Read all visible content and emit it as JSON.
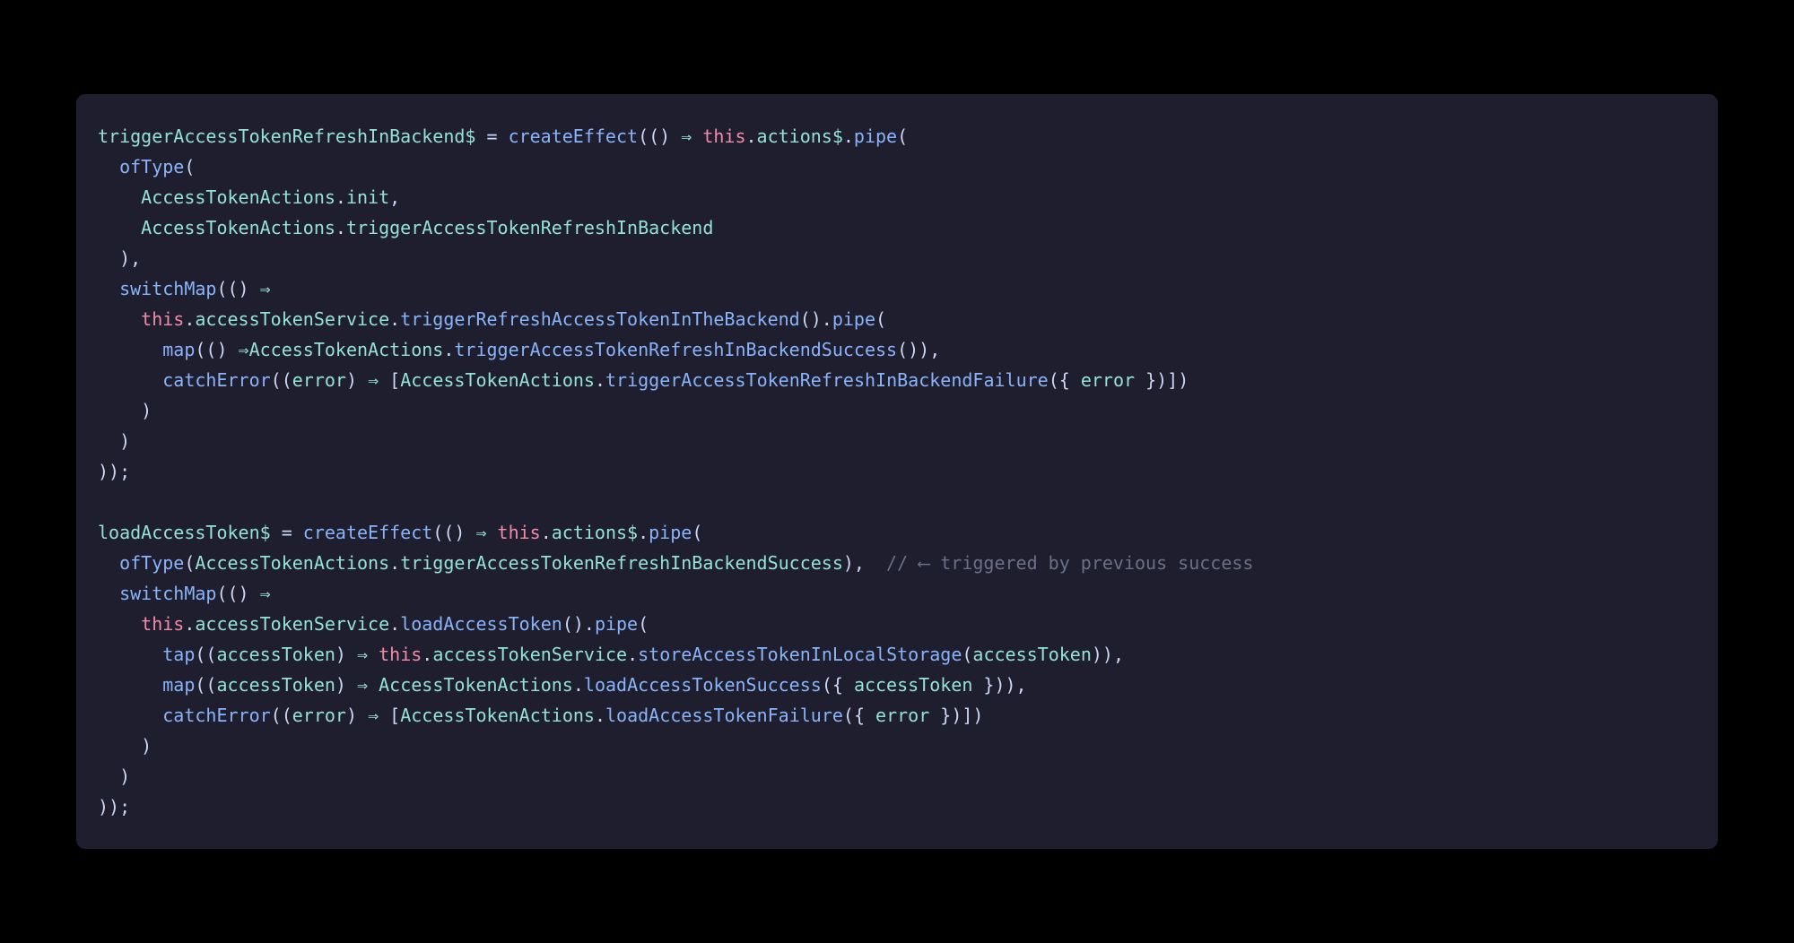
{
  "colors": {
    "bg": "#000000",
    "panel": "#1e1e2e",
    "text": "#cdd6f4",
    "ident": "#94e2d5",
    "func": "#89b4fa",
    "keyword": "#f38ba8",
    "comment": "#6c7086"
  },
  "code": {
    "lines": [
      [
        {
          "t": "triggerAccessTokenRefreshInBackend$",
          "c": "ident"
        },
        {
          "t": " = ",
          "c": "op"
        },
        {
          "t": "createEffect",
          "c": "func"
        },
        {
          "t": "(() ",
          "c": "op"
        },
        {
          "t": "⇒",
          "c": "arrow"
        },
        {
          "t": " ",
          "c": "op"
        },
        {
          "t": "this",
          "c": "keyword"
        },
        {
          "t": ".",
          "c": "op"
        },
        {
          "t": "actions$",
          "c": "ident"
        },
        {
          "t": ".",
          "c": "op"
        },
        {
          "t": "pipe",
          "c": "func"
        },
        {
          "t": "(",
          "c": "op"
        }
      ],
      [
        {
          "t": "  ",
          "c": "op"
        },
        {
          "t": "ofType",
          "c": "func"
        },
        {
          "t": "(",
          "c": "op"
        }
      ],
      [
        {
          "t": "    ",
          "c": "op"
        },
        {
          "t": "AccessTokenActions",
          "c": "ident"
        },
        {
          "t": ".",
          "c": "op"
        },
        {
          "t": "init",
          "c": "ident"
        },
        {
          "t": ",",
          "c": "op"
        }
      ],
      [
        {
          "t": "    ",
          "c": "op"
        },
        {
          "t": "AccessTokenActions",
          "c": "ident"
        },
        {
          "t": ".",
          "c": "op"
        },
        {
          "t": "triggerAccessTokenRefreshInBackend",
          "c": "ident"
        }
      ],
      [
        {
          "t": "  ),",
          "c": "op"
        }
      ],
      [
        {
          "t": "  ",
          "c": "op"
        },
        {
          "t": "switchMap",
          "c": "func"
        },
        {
          "t": "(() ",
          "c": "op"
        },
        {
          "t": "⇒",
          "c": "arrow"
        }
      ],
      [
        {
          "t": "    ",
          "c": "op"
        },
        {
          "t": "this",
          "c": "keyword"
        },
        {
          "t": ".",
          "c": "op"
        },
        {
          "t": "accessTokenService",
          "c": "ident"
        },
        {
          "t": ".",
          "c": "op"
        },
        {
          "t": "triggerRefreshAccessTokenInTheBackend",
          "c": "func"
        },
        {
          "t": "().",
          "c": "op"
        },
        {
          "t": "pipe",
          "c": "func"
        },
        {
          "t": "(",
          "c": "op"
        }
      ],
      [
        {
          "t": "      ",
          "c": "op"
        },
        {
          "t": "map",
          "c": "func"
        },
        {
          "t": "(() ",
          "c": "op"
        },
        {
          "t": "⇒",
          "c": "arrow"
        },
        {
          "t": "AccessTokenActions",
          "c": "ident"
        },
        {
          "t": ".",
          "c": "op"
        },
        {
          "t": "triggerAccessTokenRefreshInBackendSuccess",
          "c": "func"
        },
        {
          "t": "()),",
          "c": "op"
        }
      ],
      [
        {
          "t": "      ",
          "c": "op"
        },
        {
          "t": "catchError",
          "c": "func"
        },
        {
          "t": "((",
          "c": "op"
        },
        {
          "t": "error",
          "c": "ident"
        },
        {
          "t": ") ",
          "c": "op"
        },
        {
          "t": "⇒",
          "c": "arrow"
        },
        {
          "t": " [",
          "c": "op"
        },
        {
          "t": "AccessTokenActions",
          "c": "ident"
        },
        {
          "t": ".",
          "c": "op"
        },
        {
          "t": "triggerAccessTokenRefreshInBackendFailure",
          "c": "func"
        },
        {
          "t": "({ ",
          "c": "op"
        },
        {
          "t": "error",
          "c": "ident"
        },
        {
          "t": " })])",
          "c": "op"
        }
      ],
      [
        {
          "t": "    )",
          "c": "op"
        }
      ],
      [
        {
          "t": "  )",
          "c": "op"
        }
      ],
      [
        {
          "t": "));",
          "c": "op"
        }
      ],
      [
        {
          "t": "",
          "c": "op"
        }
      ],
      [
        {
          "t": "loadAccessToken$",
          "c": "ident"
        },
        {
          "t": " = ",
          "c": "op"
        },
        {
          "t": "createEffect",
          "c": "func"
        },
        {
          "t": "(() ",
          "c": "op"
        },
        {
          "t": "⇒",
          "c": "arrow"
        },
        {
          "t": " ",
          "c": "op"
        },
        {
          "t": "this",
          "c": "keyword"
        },
        {
          "t": ".",
          "c": "op"
        },
        {
          "t": "actions$",
          "c": "ident"
        },
        {
          "t": ".",
          "c": "op"
        },
        {
          "t": "pipe",
          "c": "func"
        },
        {
          "t": "(",
          "c": "op"
        }
      ],
      [
        {
          "t": "  ",
          "c": "op"
        },
        {
          "t": "ofType",
          "c": "func"
        },
        {
          "t": "(",
          "c": "op"
        },
        {
          "t": "AccessTokenActions",
          "c": "ident"
        },
        {
          "t": ".",
          "c": "op"
        },
        {
          "t": "triggerAccessTokenRefreshInBackendSuccess",
          "c": "ident"
        },
        {
          "t": "),  ",
          "c": "op"
        },
        {
          "t": "// ⟵ triggered by previous success",
          "c": "comment"
        }
      ],
      [
        {
          "t": "  ",
          "c": "op"
        },
        {
          "t": "switchMap",
          "c": "func"
        },
        {
          "t": "(() ",
          "c": "op"
        },
        {
          "t": "⇒",
          "c": "arrow"
        }
      ],
      [
        {
          "t": "    ",
          "c": "op"
        },
        {
          "t": "this",
          "c": "keyword"
        },
        {
          "t": ".",
          "c": "op"
        },
        {
          "t": "accessTokenService",
          "c": "ident"
        },
        {
          "t": ".",
          "c": "op"
        },
        {
          "t": "loadAccessToken",
          "c": "func"
        },
        {
          "t": "().",
          "c": "op"
        },
        {
          "t": "pipe",
          "c": "func"
        },
        {
          "t": "(",
          "c": "op"
        }
      ],
      [
        {
          "t": "      ",
          "c": "op"
        },
        {
          "t": "tap",
          "c": "func"
        },
        {
          "t": "((",
          "c": "op"
        },
        {
          "t": "accessToken",
          "c": "ident"
        },
        {
          "t": ") ",
          "c": "op"
        },
        {
          "t": "⇒",
          "c": "arrow"
        },
        {
          "t": " ",
          "c": "op"
        },
        {
          "t": "this",
          "c": "keyword"
        },
        {
          "t": ".",
          "c": "op"
        },
        {
          "t": "accessTokenService",
          "c": "ident"
        },
        {
          "t": ".",
          "c": "op"
        },
        {
          "t": "storeAccessTokenInLocalStorage",
          "c": "func"
        },
        {
          "t": "(",
          "c": "op"
        },
        {
          "t": "accessToken",
          "c": "ident"
        },
        {
          "t": ")),",
          "c": "op"
        }
      ],
      [
        {
          "t": "      ",
          "c": "op"
        },
        {
          "t": "map",
          "c": "func"
        },
        {
          "t": "((",
          "c": "op"
        },
        {
          "t": "accessToken",
          "c": "ident"
        },
        {
          "t": ") ",
          "c": "op"
        },
        {
          "t": "⇒",
          "c": "arrow"
        },
        {
          "t": " ",
          "c": "op"
        },
        {
          "t": "AccessTokenActions",
          "c": "ident"
        },
        {
          "t": ".",
          "c": "op"
        },
        {
          "t": "loadAccessTokenSuccess",
          "c": "func"
        },
        {
          "t": "({ ",
          "c": "op"
        },
        {
          "t": "accessToken",
          "c": "ident"
        },
        {
          "t": " })),",
          "c": "op"
        }
      ],
      [
        {
          "t": "      ",
          "c": "op"
        },
        {
          "t": "catchError",
          "c": "func"
        },
        {
          "t": "((",
          "c": "op"
        },
        {
          "t": "error",
          "c": "ident"
        },
        {
          "t": ") ",
          "c": "op"
        },
        {
          "t": "⇒",
          "c": "arrow"
        },
        {
          "t": " [",
          "c": "op"
        },
        {
          "t": "AccessTokenActions",
          "c": "ident"
        },
        {
          "t": ".",
          "c": "op"
        },
        {
          "t": "loadAccessTokenFailure",
          "c": "func"
        },
        {
          "t": "({ ",
          "c": "op"
        },
        {
          "t": "error",
          "c": "ident"
        },
        {
          "t": " })])",
          "c": "op"
        }
      ],
      [
        {
          "t": "    )",
          "c": "op"
        }
      ],
      [
        {
          "t": "  )",
          "c": "op"
        }
      ],
      [
        {
          "t": "));",
          "c": "op"
        }
      ]
    ]
  }
}
